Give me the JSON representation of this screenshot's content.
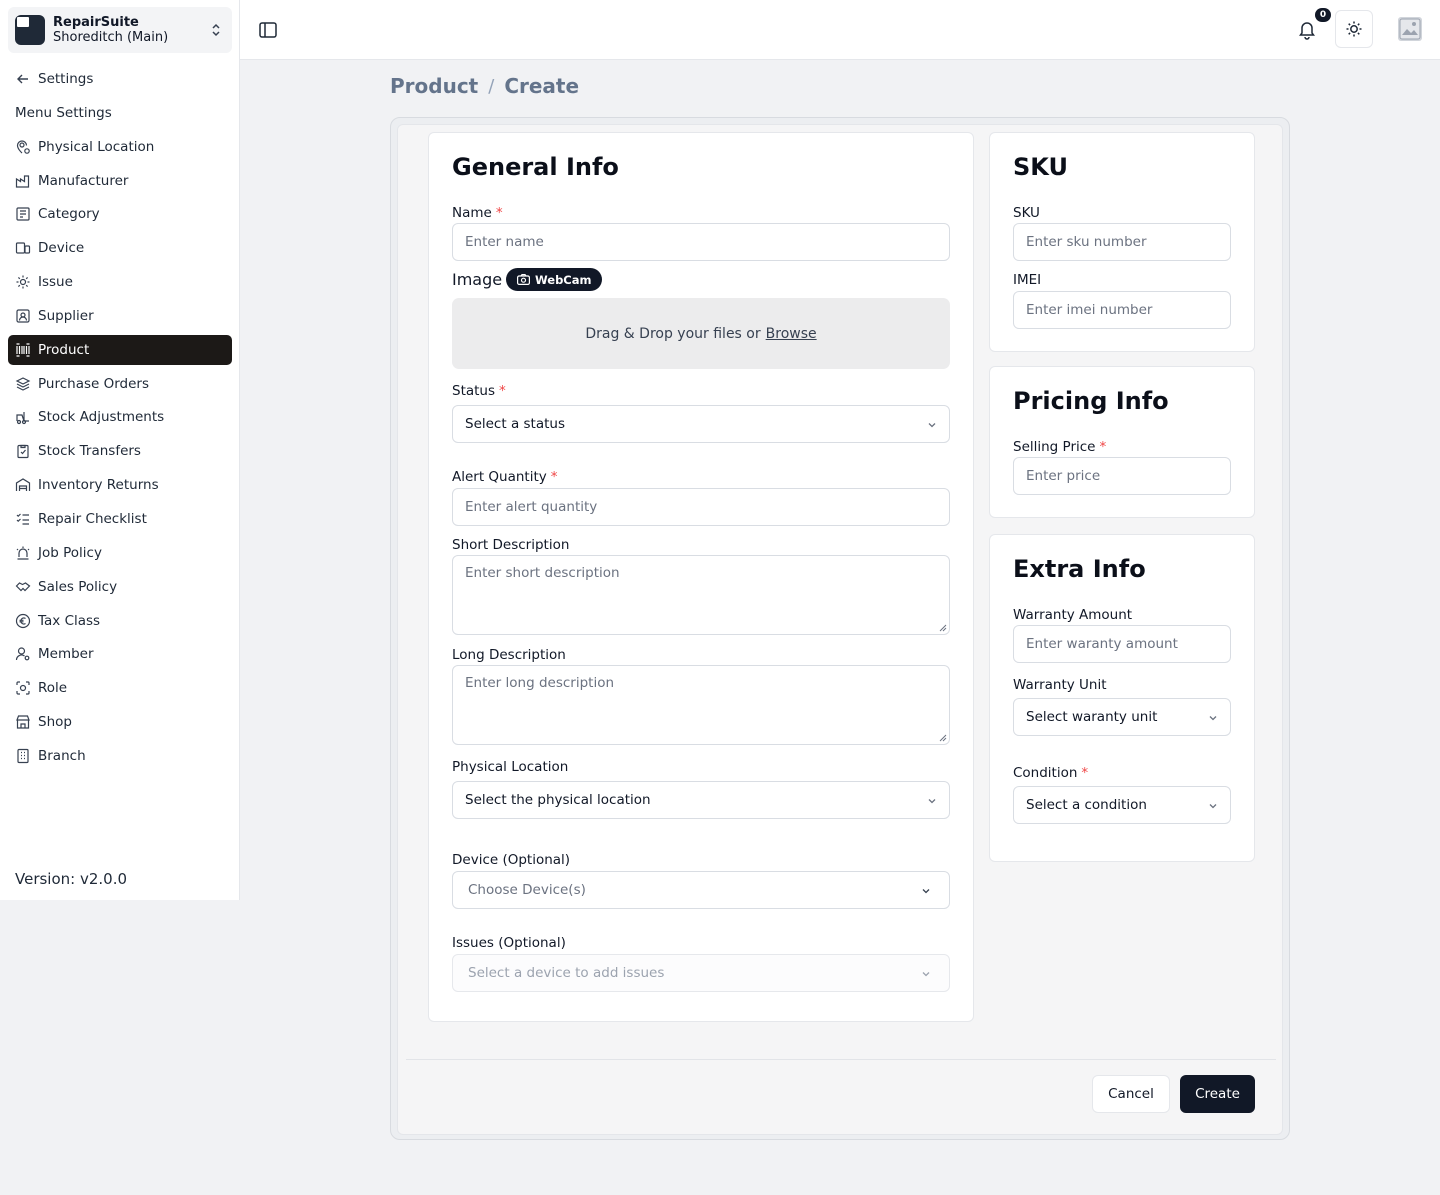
{
  "sidebar": {
    "brand_name": "RepairSuite",
    "branch_name": "Shoreditch (Main)",
    "back_label": "Settings",
    "section_label": "Menu Settings",
    "items": [
      {
        "label": "Physical Location",
        "icon": "map-pin-icon"
      },
      {
        "label": "Manufacturer",
        "icon": "factory-icon"
      },
      {
        "label": "Category",
        "icon": "category-icon"
      },
      {
        "label": "Device",
        "icon": "devices-icon"
      },
      {
        "label": "Issue",
        "icon": "cog-icon"
      },
      {
        "label": "Supplier",
        "icon": "contact-icon"
      },
      {
        "label": "Product",
        "icon": "barcode-icon",
        "active": true
      },
      {
        "label": "Purchase Orders",
        "icon": "layers-icon"
      },
      {
        "label": "Stock Adjustments",
        "icon": "forklift-icon"
      },
      {
        "label": "Stock Transfers",
        "icon": "clipboard-icon"
      },
      {
        "label": "Inventory Returns",
        "icon": "warehouse-icon"
      },
      {
        "label": "Repair Checklist",
        "icon": "checklist-icon"
      },
      {
        "label": "Job Policy",
        "icon": "siren-icon"
      },
      {
        "label": "Sales Policy",
        "icon": "handshake-icon"
      },
      {
        "label": "Tax Class",
        "icon": "euro-icon"
      },
      {
        "label": "Member",
        "icon": "user-cog-icon"
      },
      {
        "label": "Role",
        "icon": "scan-face-icon"
      },
      {
        "label": "Shop",
        "icon": "store-icon"
      },
      {
        "label": "Branch",
        "icon": "building-icon"
      }
    ],
    "version": "Version: v2.0.0"
  },
  "topbar": {
    "notification_count": "0"
  },
  "breadcrumb": {
    "parent": "Product",
    "separator": "/",
    "current": "Create"
  },
  "general": {
    "title": "General Info",
    "name_label": "Name",
    "name_placeholder": "Enter name",
    "image_label": "Image",
    "webcam_label": "WebCam",
    "dropzone_text": "Drag & Drop your files or",
    "dropzone_browse": "Browse",
    "status_label": "Status",
    "status_value": "Select a status",
    "alert_label": "Alert Quantity",
    "alert_placeholder": "Enter alert quantity",
    "short_label": "Short Description",
    "short_placeholder": "Enter short description",
    "long_label": "Long Description",
    "long_placeholder": "Enter long description",
    "location_label": "Physical Location",
    "location_value": "Select the physical location",
    "device_label": "Device (Optional)",
    "device_value": "Choose Device(s)",
    "issues_label": "Issues (Optional)",
    "issues_value": "Select a device to add issues",
    "required_mark": "*"
  },
  "sku": {
    "title": "SKU",
    "sku_label": "SKU",
    "sku_placeholder": "Enter sku number",
    "imei_label": "IMEI",
    "imei_placeholder": "Enter imei number"
  },
  "pricing": {
    "title": "Pricing Info",
    "price_label": "Selling Price",
    "price_placeholder": "Enter price"
  },
  "extra": {
    "title": "Extra Info",
    "warranty_amount_label": "Warranty Amount",
    "warranty_amount_placeholder": "Enter waranty amount",
    "warranty_unit_label": "Warranty Unit",
    "warranty_unit_value": "Select waranty unit",
    "condition_label": "Condition",
    "condition_value": "Select a condition"
  },
  "actions": {
    "cancel_label": "Cancel",
    "create_label": "Create"
  },
  "colors": {
    "primary": "#111827",
    "required": "#ef4444",
    "muted_text": "#6b7280",
    "background": "#f1f2f4"
  }
}
